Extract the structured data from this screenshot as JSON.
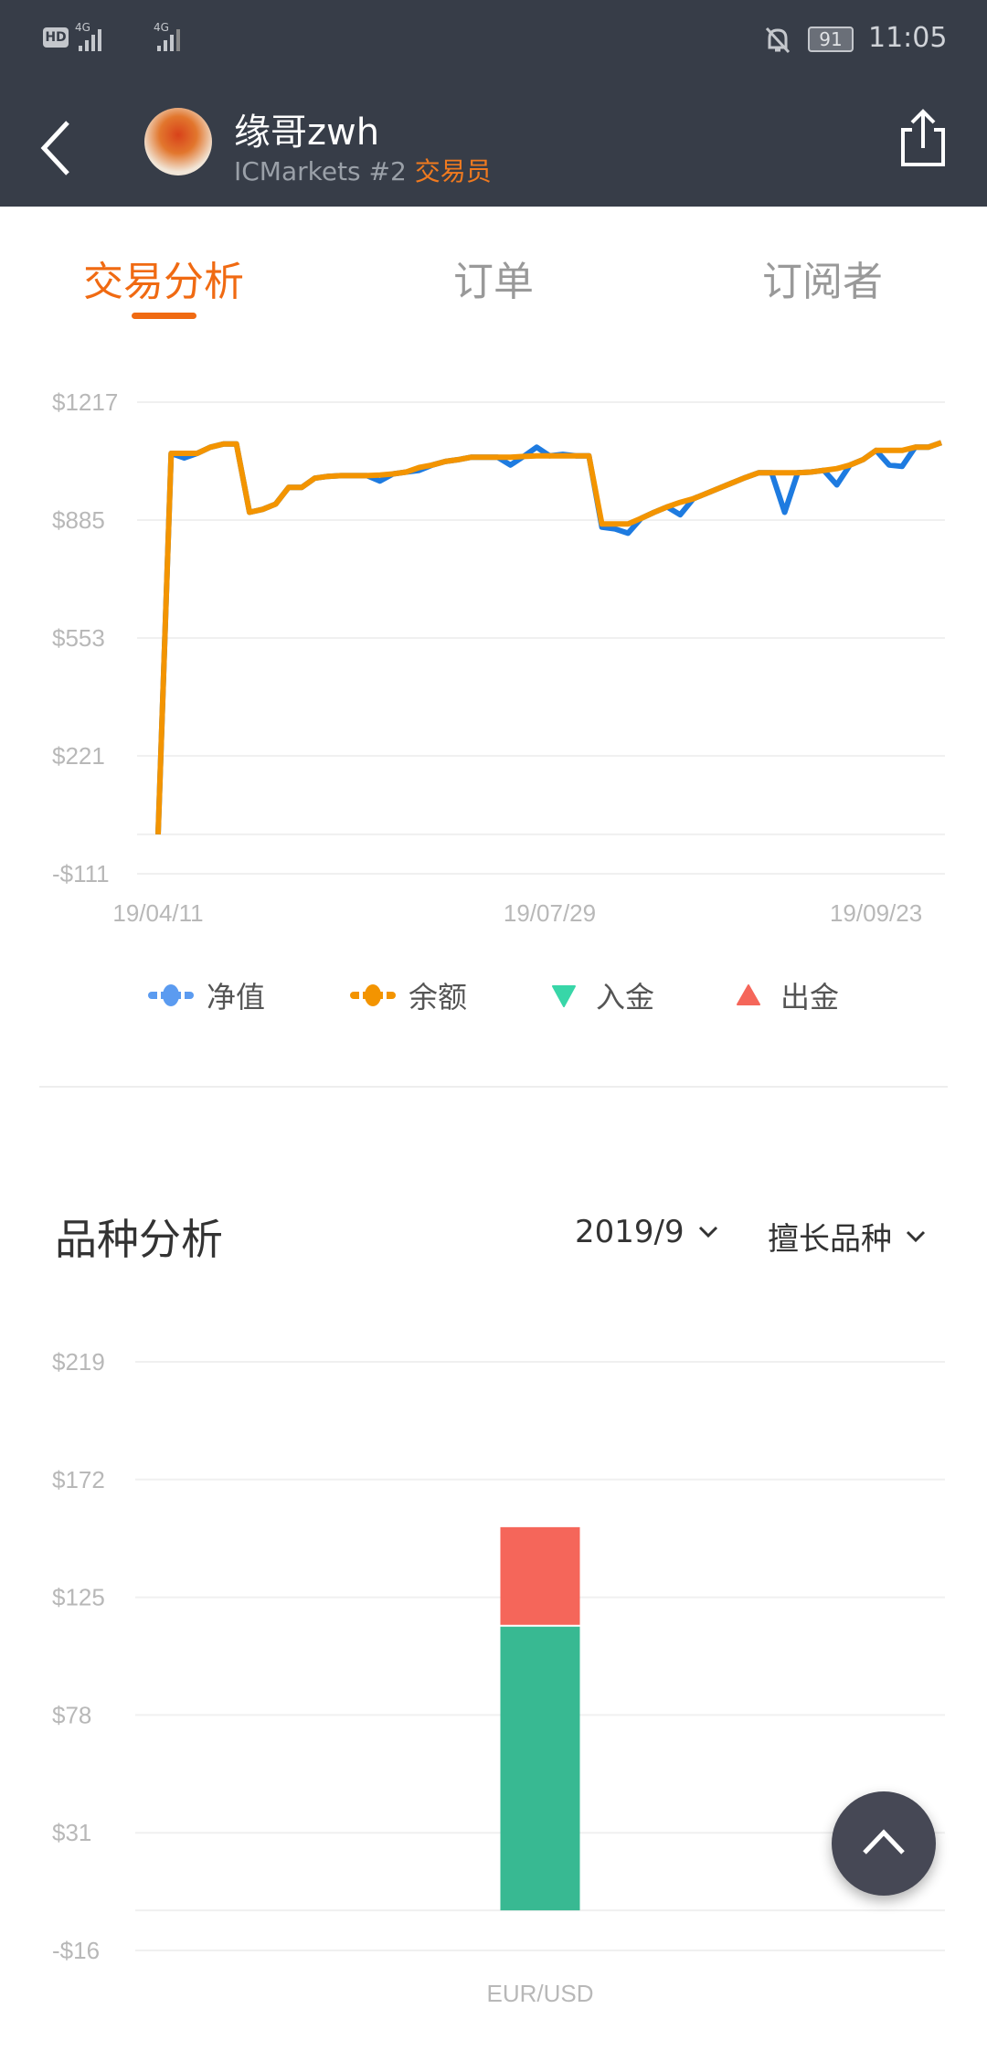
{
  "status_bar": {
    "left_icons": [
      "hd-icon",
      "signal-4g-icon",
      "signal-4g-icon"
    ],
    "battery": "91",
    "time": "11:05"
  },
  "header": {
    "title": "缘哥zwh",
    "broker": "ICMarkets #2",
    "role": "交易员",
    "icons": [
      "back-icon",
      "avatar",
      "share-icon"
    ]
  },
  "tabs": [
    {
      "label": "交易分析",
      "active": true
    },
    {
      "label": "订单"
    },
    {
      "label": "订阅者"
    }
  ],
  "colors": {
    "accent": "#f06a12",
    "header_bg": "#373d48",
    "equity": "#1e7be0",
    "balance": "#f39400",
    "deposit": "#38d6a8",
    "withdraw": "#f5665a",
    "bar_green": "#38b992",
    "bar_red": "#f5665a"
  },
  "legend": [
    {
      "label": "净值",
      "icon": "line-dot-icon",
      "color": "#5b9bf0"
    },
    {
      "label": "余额",
      "icon": "line-dot-icon",
      "color": "#f39400"
    },
    {
      "label": "入金",
      "icon": "triangle-down-icon",
      "color": "#38d6a8"
    },
    {
      "label": "出金",
      "icon": "triangle-up-icon",
      "color": "#f5665a"
    }
  ],
  "section": {
    "title": "品种分析",
    "month": "2019/9",
    "filter": "擅长品种"
  },
  "chart_data": [
    {
      "type": "line",
      "grid": true,
      "ylim": [
        -111,
        1217
      ],
      "yticks": [
        "$1217",
        "$885",
        "$553",
        "$221",
        "-$111"
      ],
      "ytick_values": [
        1217,
        885,
        553,
        221,
        -111
      ],
      "xtick_labels": [
        {
          "label": "19/04/11",
          "index": 0
        },
        {
          "label": "19/07/29",
          "index": 30
        },
        {
          "label": "19/09/23",
          "index": 55
        }
      ],
      "series": [
        {
          "name": "净值",
          "color": "#1e7be0",
          "values": [
            0,
            1073,
            1060,
            1073,
            1090,
            1099,
            1099,
            907,
            915,
            930,
            977,
            977,
            1003,
            1008,
            1010,
            1010,
            1010,
            995,
            1015,
            1020,
            1025,
            1040,
            1050,
            1055,
            1062,
            1062,
            1062,
            1040,
            1064,
            1090,
            1066,
            1070,
            1066,
            1066,
            865,
            860,
            848,
            890,
            907,
            922,
            900,
            945,
            960,
            975,
            990,
            1005,
            1018,
            1018,
            907,
            1018,
            1020,
            1025,
            984,
            1040,
            1055,
            1081,
            1040,
            1036,
            1090,
            1090,
            1103
          ]
        },
        {
          "name": "余额",
          "color": "#f39400",
          "values": [
            0,
            1073,
            1073,
            1073,
            1090,
            1099,
            1099,
            907,
            915,
            930,
            977,
            977,
            1003,
            1008,
            1010,
            1010,
            1010,
            1012,
            1015,
            1020,
            1033,
            1040,
            1050,
            1055,
            1062,
            1062,
            1062,
            1062,
            1064,
            1066,
            1066,
            1066,
            1066,
            1066,
            874,
            874,
            874,
            890,
            907,
            922,
            935,
            945,
            960,
            975,
            990,
            1005,
            1018,
            1018,
            1018,
            1018,
            1020,
            1025,
            1030,
            1040,
            1055,
            1081,
            1081,
            1081,
            1090,
            1090,
            1103
          ]
        }
      ]
    },
    {
      "type": "bar",
      "stacked": true,
      "grid": true,
      "ylim": [
        -16,
        219
      ],
      "yticks": [
        "$219",
        "$172",
        "$125",
        "$78",
        "$31",
        "-$16"
      ],
      "ytick_values": [
        219,
        172,
        125,
        78,
        31,
        -16
      ],
      "categories": [
        "EUR/USD"
      ],
      "series": [
        {
          "color": "#38b992",
          "values": [
            114
          ]
        },
        {
          "color": "#f5665a",
          "values": [
            39
          ]
        }
      ]
    }
  ]
}
